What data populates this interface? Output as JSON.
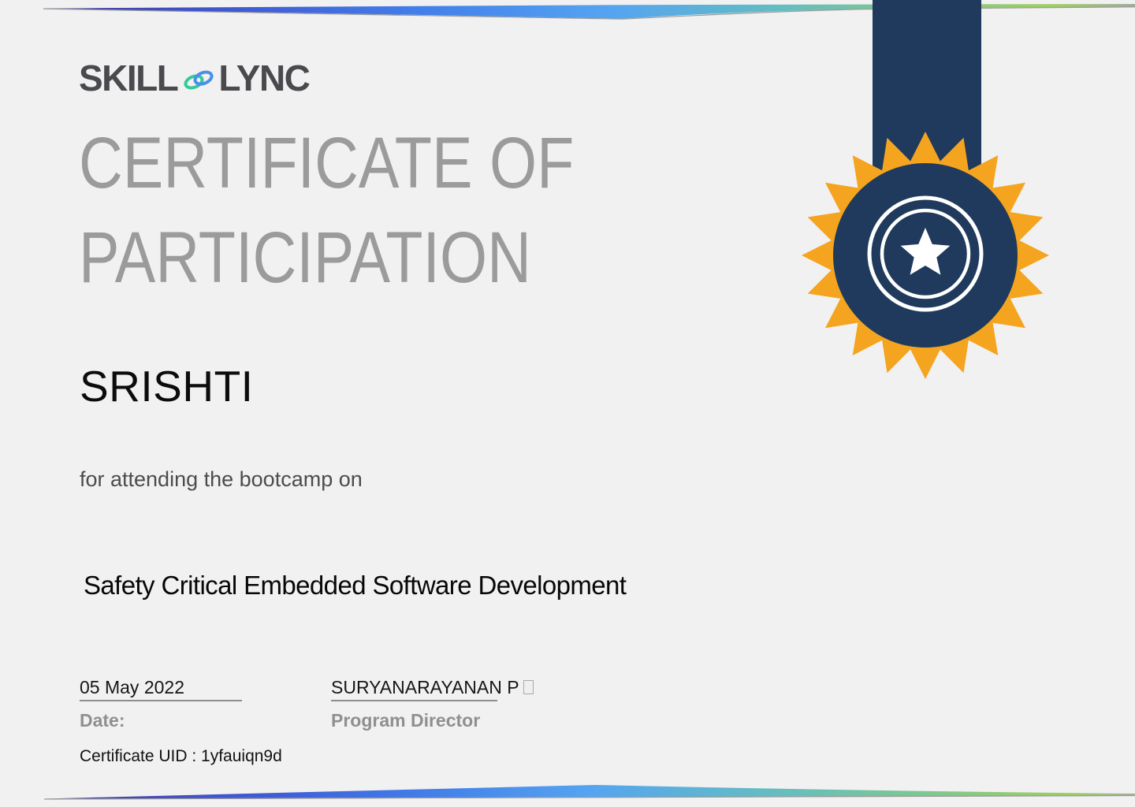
{
  "background_color": "#F2F1F2",
  "brand": {
    "logo_left": "SKILL",
    "logo_right": "LYNC",
    "link_icon": "chain-link-icon",
    "logo_color": "#4A494D",
    "link_green": "#34C99A",
    "link_blue": "#4A8FE8"
  },
  "heading": {
    "line1": "CERTIFICATE OF",
    "line2": "PARTICIPATION",
    "color": "#9B9B9B"
  },
  "recipient_name": "SRISHTI",
  "subtitle": "for attending the bootcamp on",
  "course_title": "Safety Critical Embedded Software Development",
  "signatures": {
    "date": {
      "value": "05 May 2022",
      "label": "Date:"
    },
    "director": {
      "value": "SURYANARAYANAN P",
      "label": "Program Director",
      "has_missing_glyph_box": true
    }
  },
  "footer": {
    "certificate_uid": "Certificate UID : 1yfauiqn9d"
  },
  "medal": {
    "ribbon_color": "#1F3A5C",
    "burst_color": "#F5A41F",
    "star": "star-icon",
    "ring_color": "#FFFFFF"
  },
  "border_band_colors": [
    "#4444AE",
    "#3E5BD6",
    "#4380EA",
    "#55A4F1",
    "#63BCC4",
    "#7FC98B",
    "#9ECD62"
  ]
}
